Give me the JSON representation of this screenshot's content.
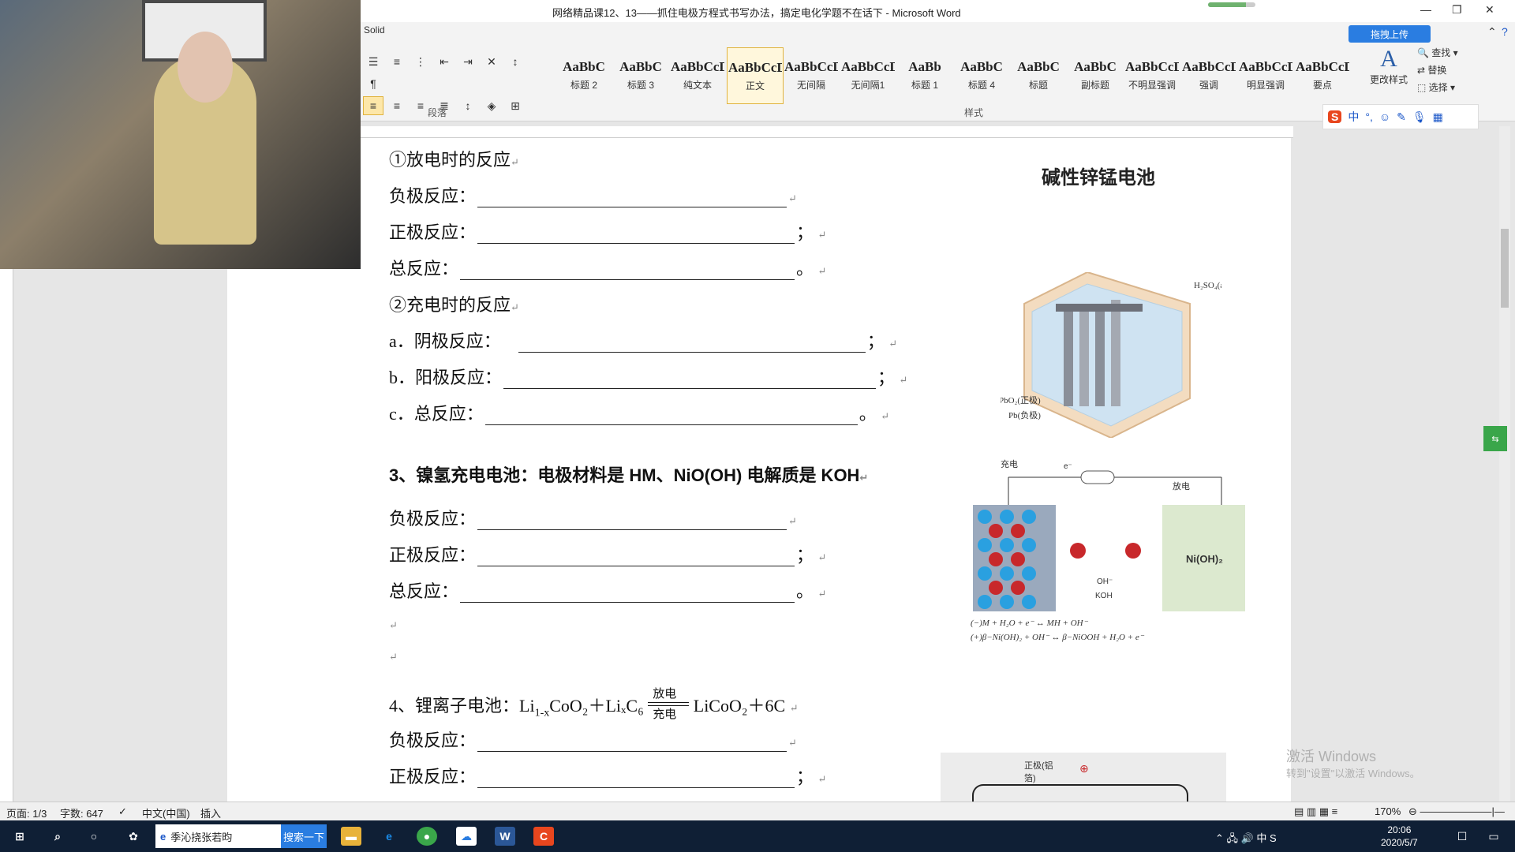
{
  "window": {
    "title": "网络精品课12、13——抓住电极方程式书写办法，搞定电化学题不在话下 - Microsoft Word",
    "upload_button": "拖拽上传",
    "progress": 0.8
  },
  "ribbon": {
    "font_name": "Solid",
    "group_paragraph": "段落",
    "group_styles": "样式",
    "styles": [
      {
        "preview": "AaBbC",
        "name": "标题 2"
      },
      {
        "preview": "AaBbC",
        "name": "标题 3"
      },
      {
        "preview": "AaBbCcDd",
        "name": "纯文本"
      },
      {
        "preview": "AaBbCcDd",
        "name": "正文"
      },
      {
        "preview": "AaBbCcDd",
        "name": "无间隔"
      },
      {
        "preview": "AaBbCcD",
        "name": "无间隔1"
      },
      {
        "preview": "AaBb",
        "name": "标题 1"
      },
      {
        "preview": "AaBbC",
        "name": "标题 4"
      },
      {
        "preview": "AaBbC",
        "name": "标题"
      },
      {
        "preview": "AaBbC",
        "name": "副标题"
      },
      {
        "preview": "AaBbCcDd",
        "name": "不明显强调"
      },
      {
        "preview": "AaBbCcDd",
        "name": "强调"
      },
      {
        "preview": "AaBbCcDd",
        "name": "明显强调"
      },
      {
        "preview": "AaBbCcDd",
        "name": "要点"
      }
    ],
    "change_style": "更改样式",
    "find": "查找",
    "replace": "替换",
    "select": "选择"
  },
  "ime": {
    "lang": "中"
  },
  "document": {
    "discharge_title": "①放电时的反应",
    "neg": "负极反应：",
    "pos": "正极反应：",
    "total": "总反应：",
    "charge_title": "②充电时的反应",
    "a_label": "a．阴极反应：",
    "b_label": "b．阳极反应：",
    "c_label": "c．总反应：",
    "sec3": "3、镍氢充电电池：电极材料是 HM、NiO(OH) 电解质是 KOH",
    "sec4_prefix": "4、锂离子电池：Li",
    "sec4_middle": "CoO₂＋LiₓC₆",
    "sec4_suffix": "LiCoO₂＋6C",
    "sec4_sub": "1-x",
    "discharge_label": "放电",
    "charge_label": "充电",
    "semicolon": "；",
    "period": "。",
    "battery_title": "碱性锌锰电池",
    "lead_acid_h2so4": "H₂SO₄(aq)",
    "lead_acid_pbo2": "PbO₂(正极)",
    "lead_acid_pb": "Pb(负极)",
    "nimh_charge": "充电",
    "nimh_discharge": "放电",
    "nimh_e": "e⁻",
    "nimh_oh": "OH⁻",
    "nimh_koh": "KOH",
    "nimh_nioh2": "Ni(OH)₂",
    "nimh_eq1": "(−)M + H₂O + e⁻ ↔ MH + OH⁻",
    "nimh_eq2": "(+)β−Ni(OH)₂ + OH⁻ ↔ β−NiOOH + H₂O + e⁻",
    "li_label": "正极(铝箔)",
    "li_plus": "⊕"
  },
  "status": {
    "page": "页面: 1/3",
    "words": "字数: 647",
    "lang": "中文(中国)",
    "mode": "插入",
    "zoom": "170%"
  },
  "taskbar": {
    "search_text": "季沁挠张若昀",
    "search_button": "搜索一下",
    "time": "20:06",
    "date": "2020/5/7"
  },
  "watermark": {
    "line1": "激活 Windows",
    "line2": "转到\"设置\"以激活 Windows。"
  }
}
